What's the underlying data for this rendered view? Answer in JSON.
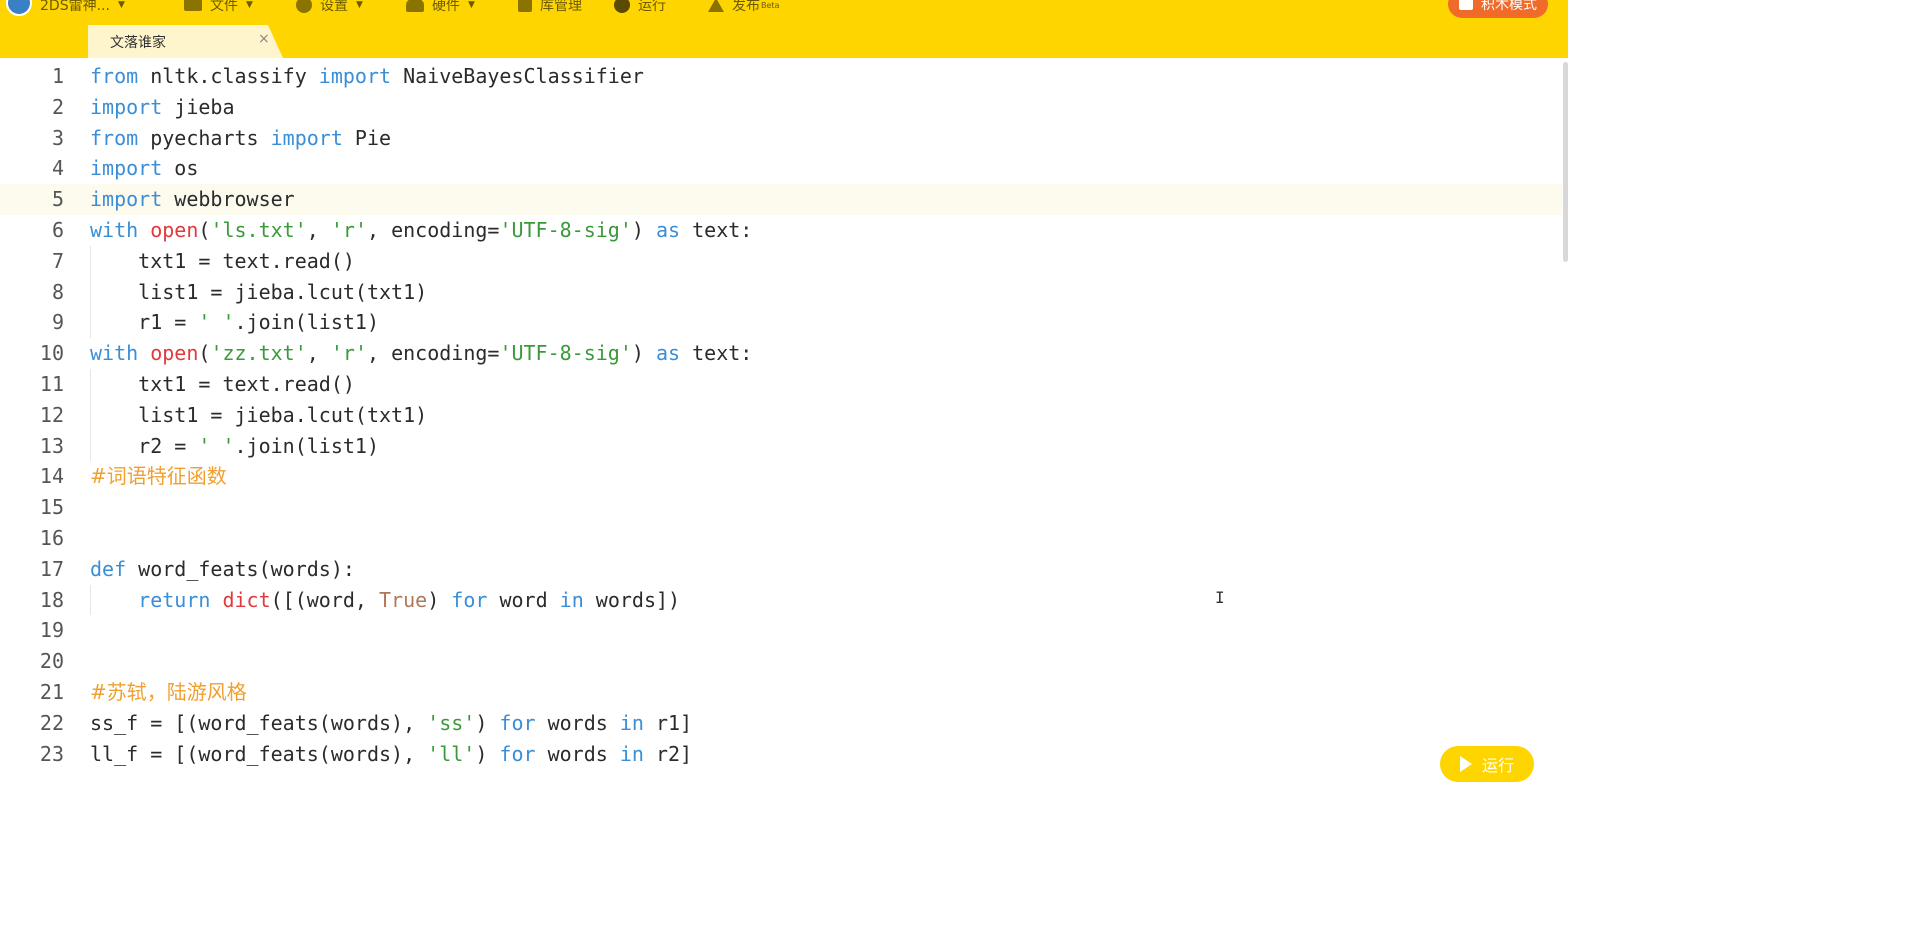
{
  "menu": {
    "account_label": "2DS雷神...",
    "file_label": "文件",
    "settings_label": "设置",
    "hardware_label": "硬件",
    "library_label": "库管理",
    "run_label": "运行",
    "publish_label": "发布",
    "publish_badge": "Beta",
    "block_mode_label": "积木模式"
  },
  "tab": {
    "title": "文落谁家",
    "close_glyph": "×"
  },
  "editor": {
    "active_line": 5,
    "lines": [
      {
        "n": "1",
        "tokens": [
          [
            "kw",
            "from"
          ],
          [
            "p",
            " nltk.classify "
          ],
          [
            "kw",
            "import"
          ],
          [
            "p",
            " NaiveBayesClassifier"
          ]
        ]
      },
      {
        "n": "2",
        "tokens": [
          [
            "kw",
            "import"
          ],
          [
            "p",
            " jieba"
          ]
        ]
      },
      {
        "n": "3",
        "tokens": [
          [
            "kw",
            "from"
          ],
          [
            "p",
            " pyecharts "
          ],
          [
            "kw",
            "import"
          ],
          [
            "p",
            " Pie"
          ]
        ]
      },
      {
        "n": "4",
        "tokens": [
          [
            "kw",
            "import"
          ],
          [
            "p",
            " os"
          ]
        ]
      },
      {
        "n": "5",
        "tokens": [
          [
            "kw",
            "import"
          ],
          [
            "p",
            " webbrowser"
          ]
        ]
      },
      {
        "n": "6",
        "tokens": [
          [
            "kw",
            "with"
          ],
          [
            "p",
            " "
          ],
          [
            "fn",
            "open"
          ],
          [
            "p",
            "("
          ],
          [
            "str",
            "'ls.txt'"
          ],
          [
            "p",
            ", "
          ],
          [
            "str",
            "'r'"
          ],
          [
            "p",
            ", encoding="
          ],
          [
            "str",
            "'UTF-8-sig'"
          ],
          [
            "p",
            ") "
          ],
          [
            "kw",
            "as"
          ],
          [
            "p",
            " text:"
          ]
        ]
      },
      {
        "n": "7",
        "tokens": [
          [
            "p",
            "    txt1 = text.read()"
          ]
        ]
      },
      {
        "n": "8",
        "tokens": [
          [
            "p",
            "    list1 = jieba.lcut(txt1)"
          ]
        ]
      },
      {
        "n": "9",
        "tokens": [
          [
            "p",
            "    r1 = "
          ],
          [
            "str",
            "' '"
          ],
          [
            "p",
            ".join(list1)"
          ]
        ]
      },
      {
        "n": "10",
        "tokens": [
          [
            "kw",
            "with"
          ],
          [
            "p",
            " "
          ],
          [
            "fn",
            "open"
          ],
          [
            "p",
            "("
          ],
          [
            "str",
            "'zz.txt'"
          ],
          [
            "p",
            ", "
          ],
          [
            "str",
            "'r'"
          ],
          [
            "p",
            ", encoding="
          ],
          [
            "str",
            "'UTF-8-sig'"
          ],
          [
            "p",
            ") "
          ],
          [
            "kw",
            "as"
          ],
          [
            "p",
            " text:"
          ]
        ]
      },
      {
        "n": "11",
        "tokens": [
          [
            "p",
            "    txt1 = text.read()"
          ]
        ]
      },
      {
        "n": "12",
        "tokens": [
          [
            "p",
            "    list1 = jieba.lcut(txt1)"
          ]
        ]
      },
      {
        "n": "13",
        "tokens": [
          [
            "p",
            "    r2 = "
          ],
          [
            "str",
            "' '"
          ],
          [
            "p",
            ".join(list1)"
          ]
        ]
      },
      {
        "n": "14",
        "tokens": [
          [
            "comment",
            "#词语特征函数"
          ]
        ]
      },
      {
        "n": "15",
        "tokens": []
      },
      {
        "n": "16",
        "tokens": []
      },
      {
        "n": "17",
        "tokens": [
          [
            "kw",
            "def"
          ],
          [
            "p",
            " word_feats(words):"
          ]
        ]
      },
      {
        "n": "18",
        "tokens": [
          [
            "p",
            "    "
          ],
          [
            "kw",
            "return"
          ],
          [
            "p",
            " "
          ],
          [
            "fn",
            "dict"
          ],
          [
            "p",
            "([(word, "
          ],
          [
            "bool",
            "True"
          ],
          [
            "p",
            ") "
          ],
          [
            "kw",
            "for"
          ],
          [
            "p",
            " word "
          ],
          [
            "kw",
            "in"
          ],
          [
            "p",
            " words])"
          ]
        ]
      },
      {
        "n": "19",
        "tokens": []
      },
      {
        "n": "20",
        "tokens": []
      },
      {
        "n": "21",
        "tokens": [
          [
            "comment",
            "#苏轼，陆游风格"
          ]
        ]
      },
      {
        "n": "22",
        "tokens": [
          [
            "p",
            "ss_f = [(word_feats(words), "
          ],
          [
            "str",
            "'ss'"
          ],
          [
            "p",
            ") "
          ],
          [
            "kw",
            "for"
          ],
          [
            "p",
            " words "
          ],
          [
            "kw",
            "in"
          ],
          [
            "p",
            " r1]"
          ]
        ]
      },
      {
        "n": "23",
        "tokens": [
          [
            "p",
            "ll_f = [(word_feats(words), "
          ],
          [
            "str",
            "'ll'"
          ],
          [
            "p",
            ") "
          ],
          [
            "kw",
            "for"
          ],
          [
            "p",
            " words "
          ],
          [
            "kw",
            "in"
          ],
          [
            "p",
            " r2]"
          ]
        ]
      }
    ]
  },
  "run_button_label": "运行",
  "colors": {
    "toolbar_bg": "#ffd500",
    "keyword": "#3a8ed8",
    "builtin": "#e0393e",
    "string": "#3a9a3a",
    "comment": "#f0a030",
    "block_mode_btn": "#f06a2a"
  }
}
